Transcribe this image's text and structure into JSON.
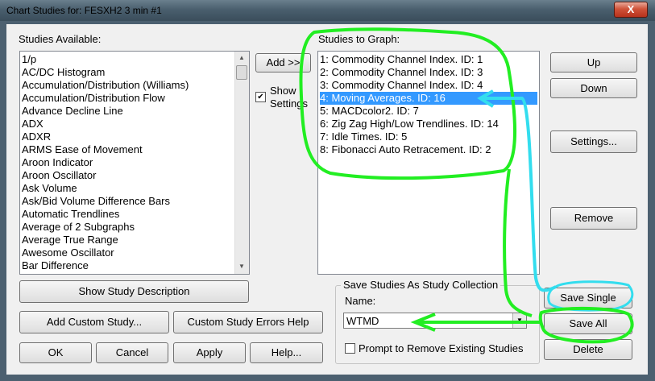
{
  "window": {
    "title": "Chart Studies for: FESXH2  3 min   #1",
    "close_label": "X"
  },
  "available": {
    "label": "Studies Available:",
    "items": [
      "1/p",
      "AC/DC Histogram",
      "Accumulation/Distribution (Williams)",
      "Accumulation/Distribution Flow",
      "Advance Decline Line",
      "ADX",
      "ADXR",
      "ARMS Ease of Movement",
      "Aroon Indicator",
      "Aroon Oscillator",
      "Ask Volume",
      "Ask/Bid Volume Difference Bars",
      "Automatic Trendlines",
      "Average of 2 Subgraphs",
      "Average True Range",
      "Awesome Oscillator",
      "Bar Difference"
    ]
  },
  "add_button": "Add >>",
  "show_settings": {
    "line1": "Show",
    "line2": "Settings",
    "checked": true
  },
  "to_graph": {
    "label": "Studies to Graph:",
    "items": [
      "1: Commodity Channel Index. ID: 1",
      "2: Commodity Channel Index. ID: 3",
      "3: Commodity Channel Index. ID: 4",
      "4: Moving Averages. ID: 16",
      "5: MACDcolor2. ID: 7",
      "6: Zig Zag High/Low Trendlines. ID: 14",
      "7: Idle Times. ID: 5",
      "8: Fibonacci Auto Retracement. ID: 2"
    ],
    "selected_index": 3
  },
  "right_buttons": {
    "up": "Up",
    "down": "Down",
    "settings": "Settings...",
    "remove": "Remove"
  },
  "bottom_buttons": {
    "show_desc": "Show Study Description",
    "add_custom": "Add Custom Study...",
    "custom_errors": "Custom Study Errors Help",
    "ok": "OK",
    "cancel": "Cancel",
    "apply": "Apply",
    "help": "Help..."
  },
  "collection": {
    "group_label": "Save Studies As Study Collection",
    "name_label": "Name:",
    "name_value": "WTMD",
    "prompt_label": "Prompt to Remove Existing Studies",
    "prompt_checked": false,
    "save_single": "Save Single",
    "save_all": "Save All",
    "delete": "Delete"
  },
  "colors": {
    "annotation_green": "#22ee22",
    "annotation_cyan": "#33ddee",
    "selection": "#3399ff"
  }
}
